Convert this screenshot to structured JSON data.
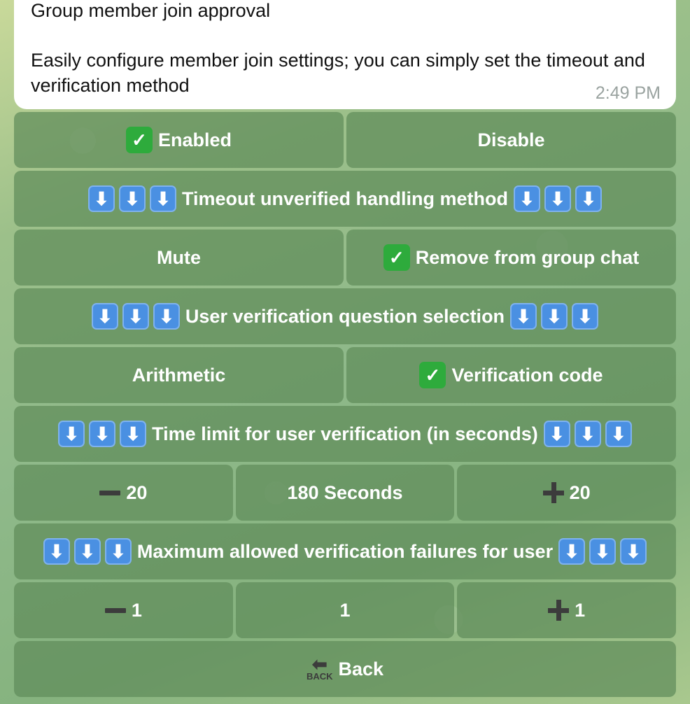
{
  "message": {
    "title": "Group member join approval",
    "body": "Easily configure member join settings; you can simply set the timeout and verification method",
    "time": "2:49 PM"
  },
  "icons": {
    "check": "✓",
    "arrow_down": "⬇",
    "back_small_label": "BACK"
  },
  "keyboard": {
    "enabled": "Enabled",
    "disable": "Disable",
    "timeout_header": "Timeout unverified handling method",
    "mute": "Mute",
    "remove": "Remove from group chat",
    "question_header": "User verification question selection",
    "arithmetic": "Arithmetic",
    "verification_code": "Verification code",
    "time_limit_header": "Time limit for user verification (in seconds)",
    "time_minus": "20",
    "time_value": "180 Seconds",
    "time_plus": "20",
    "failures_header": "Maximum allowed verification failures for user",
    "fail_minus": "1",
    "fail_value": "1",
    "fail_plus": "1",
    "back": "Back"
  },
  "colors": {
    "button_bg": "#5f8c5a",
    "check_bg": "#2eab3c",
    "arrow_bg": "#4a90e2"
  }
}
